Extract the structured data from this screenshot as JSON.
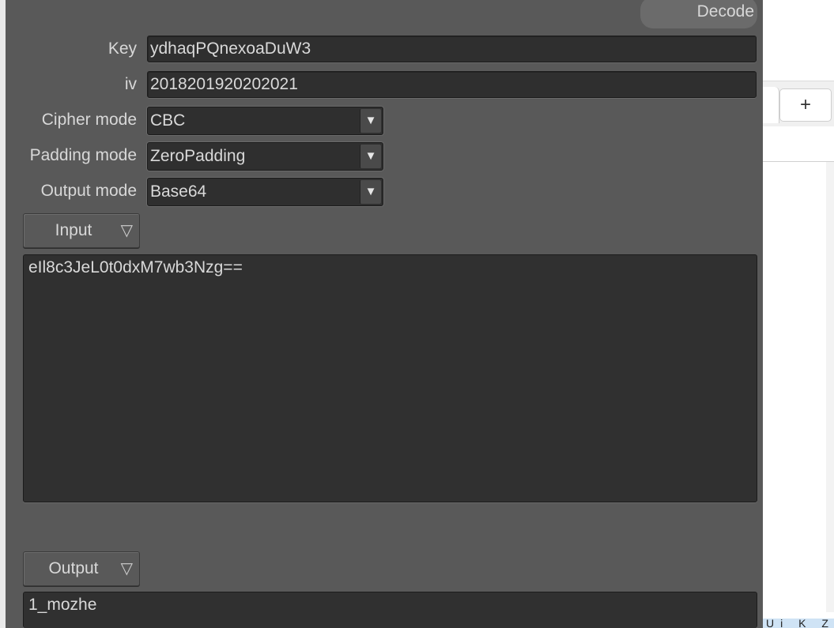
{
  "window": {
    "decode_label": "Decode"
  },
  "form": {
    "key": {
      "label": "Key",
      "value": "ydhaqPQnexoaDuW3"
    },
    "iv": {
      "label": "iv",
      "value": "2018201920202021"
    },
    "cipher_mode": {
      "label": "Cipher mode",
      "value": "CBC"
    },
    "padding_mode": {
      "label": "Padding mode",
      "value": "ZeroPadding"
    },
    "output_mode": {
      "label": "Output mode",
      "value": "Base64"
    }
  },
  "input": {
    "button_label": "Input",
    "text": "eIl8c3JeL0t0dxM7wb3Nzg=="
  },
  "output": {
    "button_label": "Output",
    "text": "1_mozhe"
  },
  "background": {
    "new_tab_symbol": "+",
    "bottom_text": "Ui K Z"
  },
  "colors": {
    "dialog_bg": "#595959",
    "field_bg": "#2f2f2f",
    "text": "#d9d9d9"
  }
}
